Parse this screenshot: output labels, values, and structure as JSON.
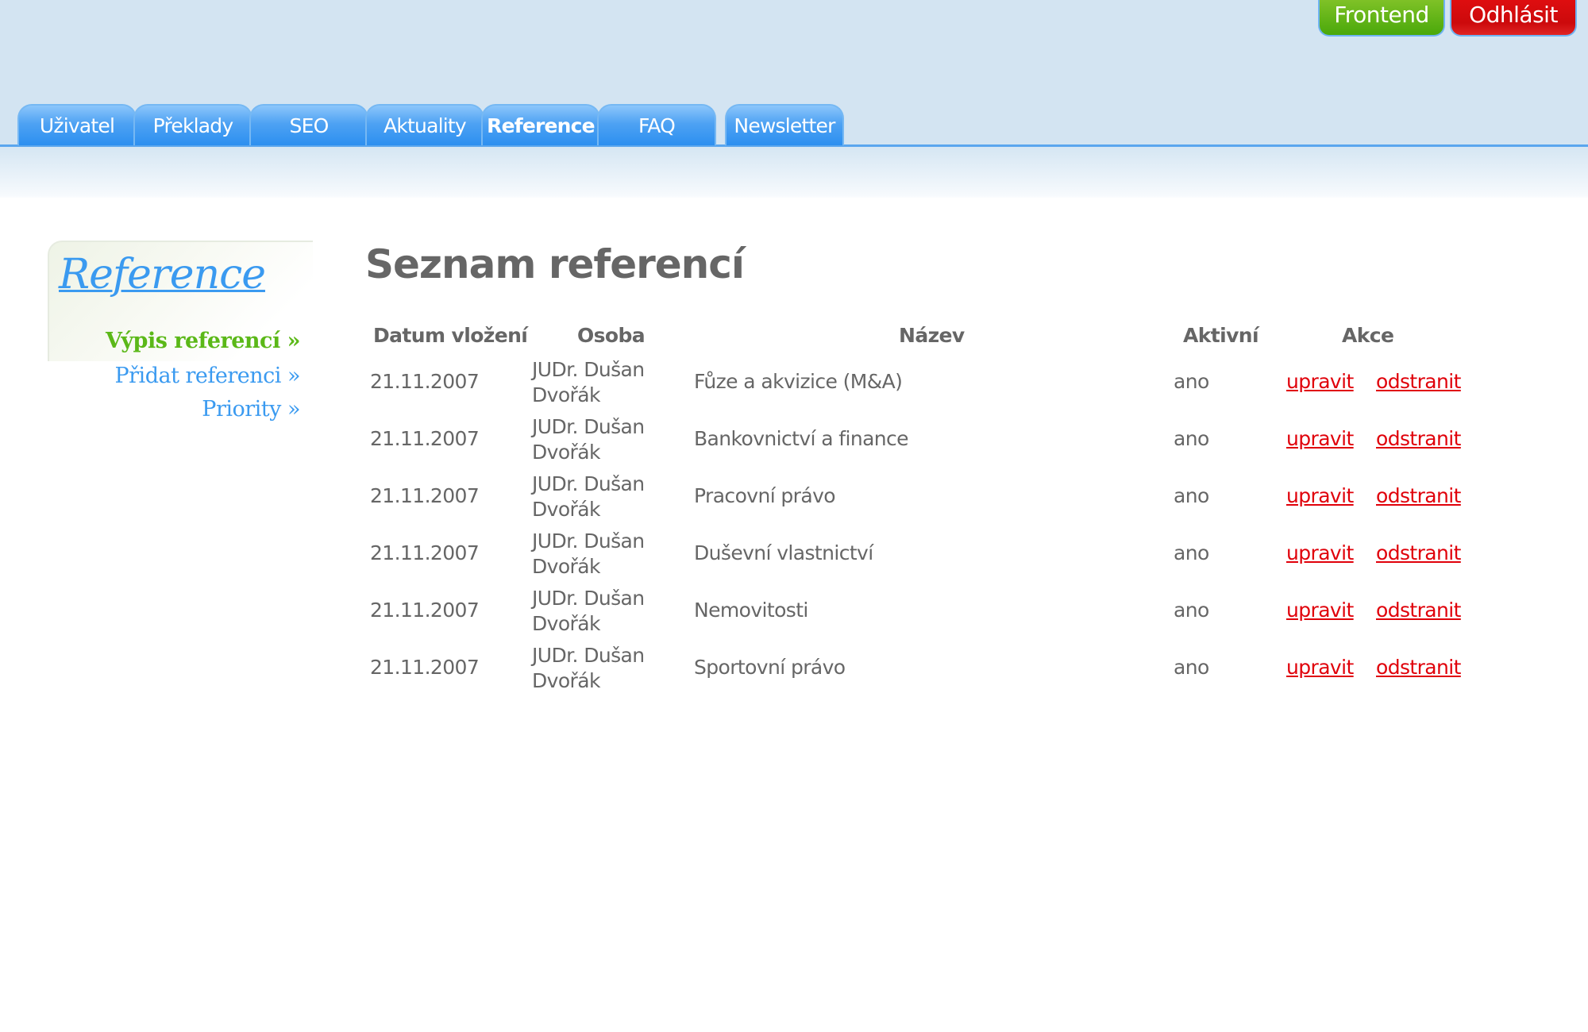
{
  "header": {
    "frontend_label": "Frontend",
    "logout_label": "Odhlásit",
    "tabs": [
      {
        "label": "Uživatel",
        "active": false
      },
      {
        "label": "Překlady",
        "active": false
      },
      {
        "label": "SEO",
        "active": false
      },
      {
        "label": "Aktuality",
        "active": false
      },
      {
        "label": "Reference",
        "active": true
      },
      {
        "label": "FAQ",
        "active": false
      },
      {
        "label": "Newsletter",
        "active": false
      }
    ]
  },
  "sidebar": {
    "title": "Reference",
    "links": [
      {
        "label": "Výpis referencí »",
        "active": true
      },
      {
        "label": "Přidat referenci »",
        "active": false
      },
      {
        "label": "Priority »",
        "active": false
      }
    ]
  },
  "main": {
    "title": "Seznam referencí",
    "columns": [
      "Datum vložení",
      "Osoba",
      "Název",
      "Aktivní",
      "Akce"
    ],
    "edit_label": "upravit",
    "delete_label": "odstranit",
    "rows": [
      {
        "date": "21.11.2007",
        "person_line1": "JUDr. Dušan",
        "person_line2": "Dvořák",
        "name": "Fůze a akvizice (M&A)",
        "active": "ano"
      },
      {
        "date": "21.11.2007",
        "person_line1": "JUDr. Dušan",
        "person_line2": "Dvořák",
        "name": "Bankovnictví a finance",
        "active": "ano"
      },
      {
        "date": "21.11.2007",
        "person_line1": "JUDr. Dušan",
        "person_line2": "Dvořák",
        "name": "Pracovní právo",
        "active": "ano"
      },
      {
        "date": "21.11.2007",
        "person_line1": "JUDr. Dušan",
        "person_line2": "Dvořák",
        "name": "Duševní vlastnictví",
        "active": "ano"
      },
      {
        "date": "21.11.2007",
        "person_line1": "JUDr. Dušan",
        "person_line2": "Dvořák",
        "name": "Nemovitosti",
        "active": "ano"
      },
      {
        "date": "21.11.2007",
        "person_line1": "JUDr. Dušan",
        "person_line2": "Dvořák",
        "name": "Sportovní právo",
        "active": "ano"
      }
    ]
  },
  "colors": {
    "tab_blue": "#2c8ff0",
    "header_bg": "#d3e4f2",
    "frontend_green": "#4aa80a",
    "logout_red": "#cc0a0c",
    "link_red": "#e0000a",
    "sidebar_blue": "#3a9af0",
    "sidebar_active_green": "#5bb818",
    "text_gray": "#666666"
  }
}
